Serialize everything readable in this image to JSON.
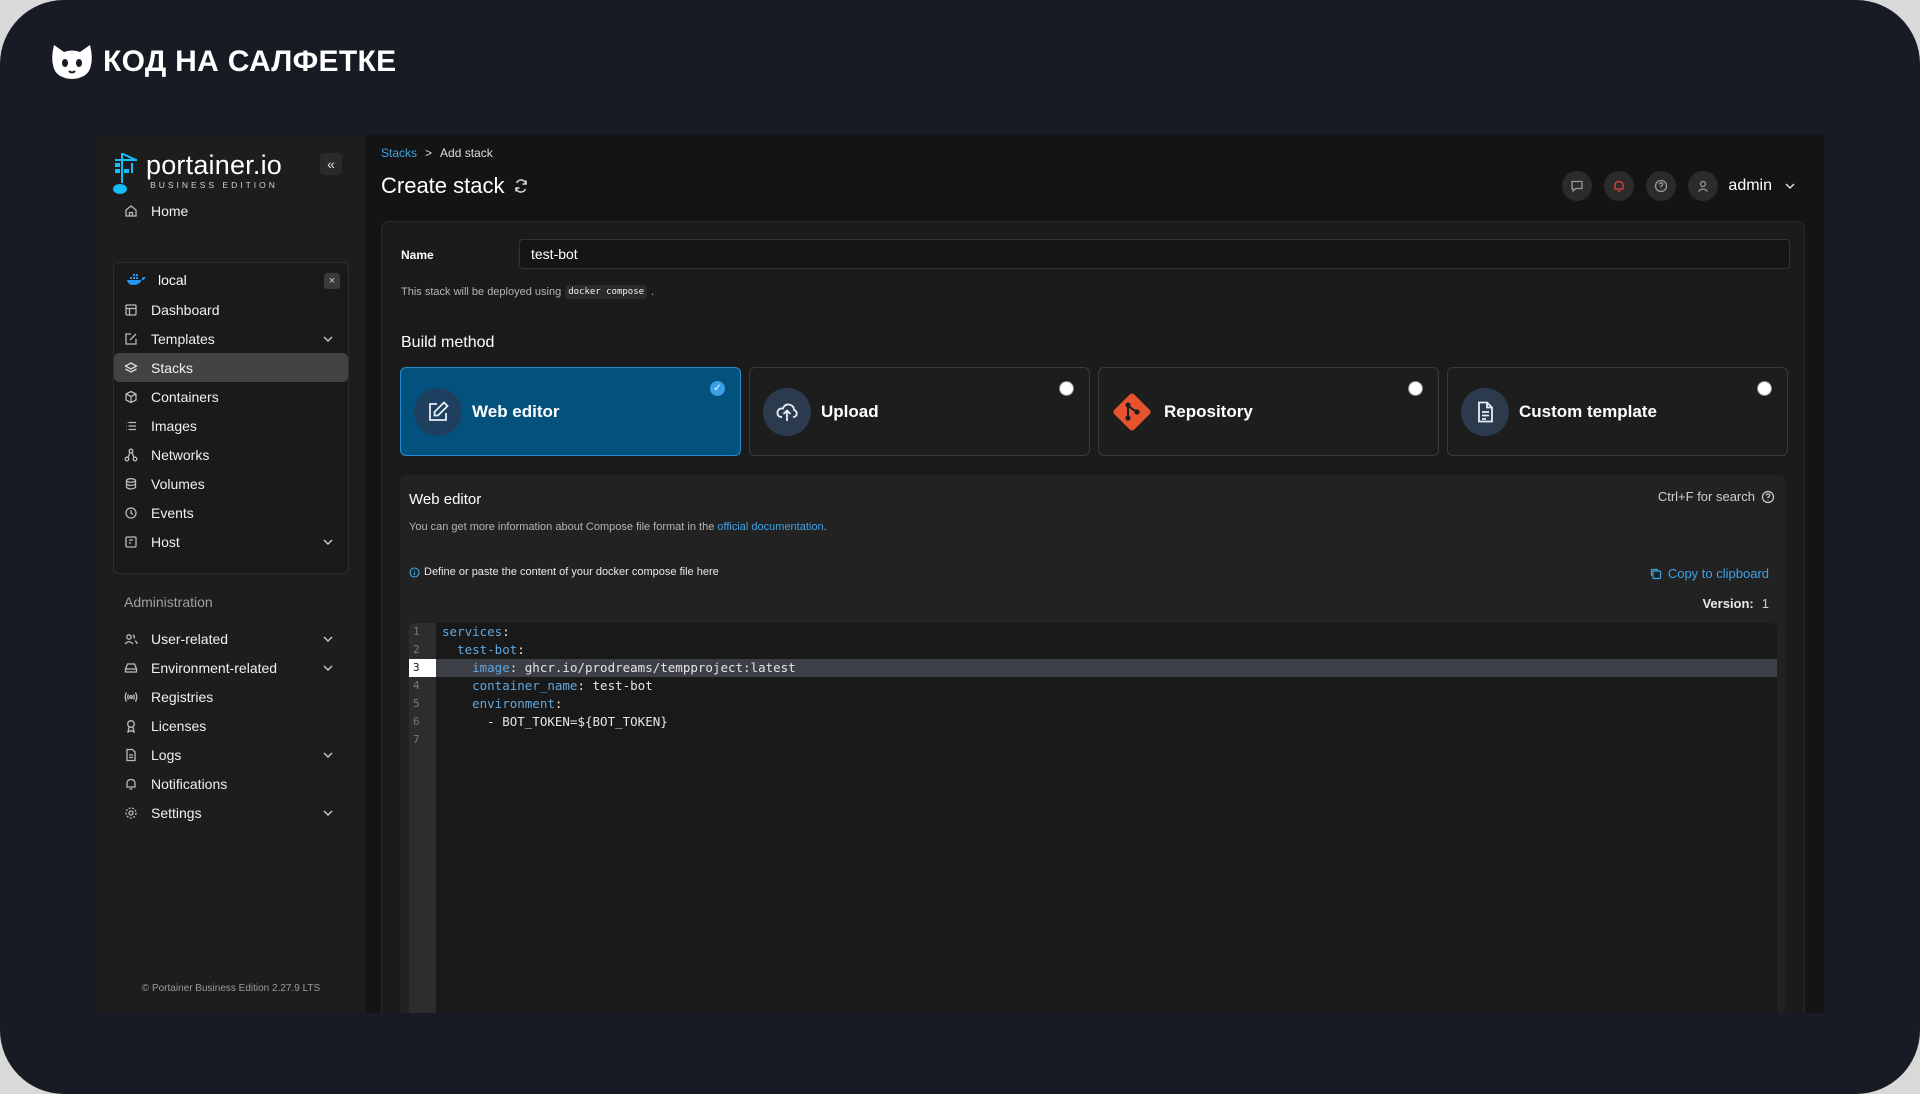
{
  "brand": {
    "text": "КОД НА САЛФЕТКЕ"
  },
  "sidebar": {
    "logo_name": "portainer.io",
    "logo_sub": "BUSINESS EDITION",
    "collapse_label": "«",
    "home": "Home",
    "environment": {
      "name": "local",
      "close": "×"
    },
    "env_items": [
      {
        "label": "Dashboard"
      },
      {
        "label": "Templates"
      },
      {
        "label": "Stacks"
      },
      {
        "label": "Containers"
      },
      {
        "label": "Images"
      },
      {
        "label": "Networks"
      },
      {
        "label": "Volumes"
      },
      {
        "label": "Events"
      },
      {
        "label": "Host"
      }
    ],
    "admin_title": "Administration",
    "admin_items": [
      {
        "label": "User-related"
      },
      {
        "label": "Environment-related"
      },
      {
        "label": "Registries"
      },
      {
        "label": "Licenses"
      },
      {
        "label": "Logs"
      },
      {
        "label": "Notifications"
      },
      {
        "label": "Settings"
      }
    ],
    "footer": "© Portainer Business Edition 2.27.9 LTS"
  },
  "header": {
    "breadcrumb_link": "Stacks",
    "breadcrumb_sep": ">",
    "breadcrumb_current": "Add stack",
    "title": "Create stack",
    "user": "admin"
  },
  "form": {
    "name_label": "Name",
    "name_value": "test-bot",
    "deploy_note_prefix": "This stack will be deployed using",
    "deploy_note_code": "docker compose",
    "deploy_note_suffix": ".",
    "build_method_title": "Build method",
    "methods": [
      {
        "label": "Web editor",
        "selected": true
      },
      {
        "label": "Upload",
        "selected": false
      },
      {
        "label": "Repository",
        "selected": false
      },
      {
        "label": "Custom template",
        "selected": false
      }
    ]
  },
  "web_editor": {
    "title": "Web editor",
    "search_hint": "Ctrl+F for search",
    "info_prefix": "You can get more information about Compose file format in the",
    "info_link": "official documentation",
    "info_suffix": ".",
    "hint": "Define or paste the content of your docker compose file here",
    "copy": "Copy to clipboard",
    "version_label": "Version:",
    "version_value": "1",
    "current_line": 3,
    "lines": [
      {
        "n": "1",
        "key": "services",
        "rest": ":"
      },
      {
        "n": "2",
        "key": "  test-bot",
        "rest": ":"
      },
      {
        "n": "3",
        "key": "    image",
        "rest": ": ghcr.io/prodreams/tempproject:latest"
      },
      {
        "n": "4",
        "key": "    container_name",
        "rest": ": test-bot"
      },
      {
        "n": "5",
        "key": "    environment",
        "rest": ":"
      },
      {
        "n": "6",
        "key": "",
        "rest": "      - BOT_TOKEN=${BOT_TOKEN}"
      },
      {
        "n": "7",
        "key": "",
        "rest": ""
      }
    ]
  },
  "colors": {
    "accent": "#3fa2e6",
    "selected_card": "#03527e",
    "git_orange": "#e8532f"
  }
}
